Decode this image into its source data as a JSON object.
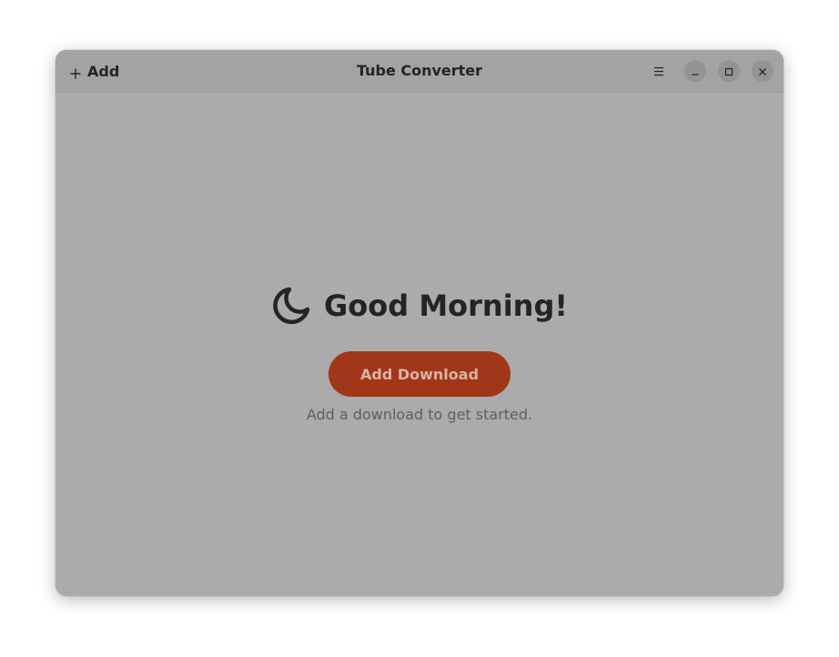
{
  "window": {
    "title": "Tube Converter"
  },
  "header": {
    "add_label": "Add",
    "add_icon": "plus-icon",
    "menu_icon": "hamburger-menu-icon",
    "window_controls": {
      "minimize_icon": "minimize-icon",
      "maximize_icon": "maximize-icon",
      "close_icon": "close-icon"
    }
  },
  "main": {
    "greeting": "Good Morning!",
    "greeting_icon": "moon-icon",
    "primary_button_label": "Add Download",
    "hint_text": "Add a download to get started."
  },
  "colors": {
    "accent": "#a13718",
    "window_bg": "#ababab",
    "headerbar_bg": "#a3a3a3",
    "text": "#242424"
  }
}
